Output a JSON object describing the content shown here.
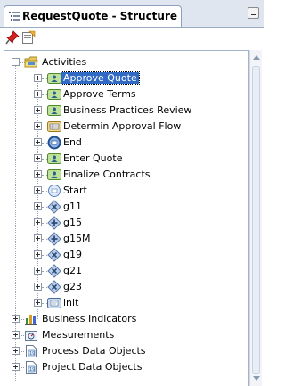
{
  "tab": {
    "title": "RequestQuote - Structure"
  },
  "toolbar": {
    "buttons": [
      "pin-icon",
      "view-icon"
    ]
  },
  "tree": {
    "root": {
      "label": "Activities",
      "expanded": true
    },
    "activities": [
      {
        "label": "Approve Quote",
        "icon": "user-task-icon",
        "selected": true
      },
      {
        "label": "Approve Terms",
        "icon": "user-task-icon"
      },
      {
        "label": "Business Practices Review",
        "icon": "user-task-icon"
      },
      {
        "label": "Determin Approval Flow",
        "icon": "business-rule-icon"
      },
      {
        "label": "End",
        "icon": "end-event-icon"
      },
      {
        "label": "Enter Quote",
        "icon": "user-task-icon"
      },
      {
        "label": "Finalize Contracts",
        "icon": "user-task-icon"
      },
      {
        "label": "Start",
        "icon": "start-event-icon"
      },
      {
        "label": "g11",
        "icon": "exclusive-gateway-icon"
      },
      {
        "label": "g15",
        "icon": "parallel-gateway-icon"
      },
      {
        "label": "g15M",
        "icon": "parallel-gateway-icon"
      },
      {
        "label": "g19",
        "icon": "exclusive-gateway-icon"
      },
      {
        "label": "g21",
        "icon": "exclusive-gateway-icon"
      },
      {
        "label": "g23",
        "icon": "exclusive-gateway-icon"
      },
      {
        "label": "init",
        "icon": "script-task-icon"
      }
    ],
    "others": [
      {
        "label": "Business Indicators",
        "icon": "business-indicators-icon"
      },
      {
        "label": "Measurements",
        "icon": "measurements-icon"
      },
      {
        "label": "Process Data Objects",
        "icon": "data-objects-icon"
      },
      {
        "label": "Project Data Objects",
        "icon": "data-objects-icon"
      }
    ]
  },
  "colors": {
    "selection": "#316ac5",
    "panel_border": "#9aabc4"
  }
}
